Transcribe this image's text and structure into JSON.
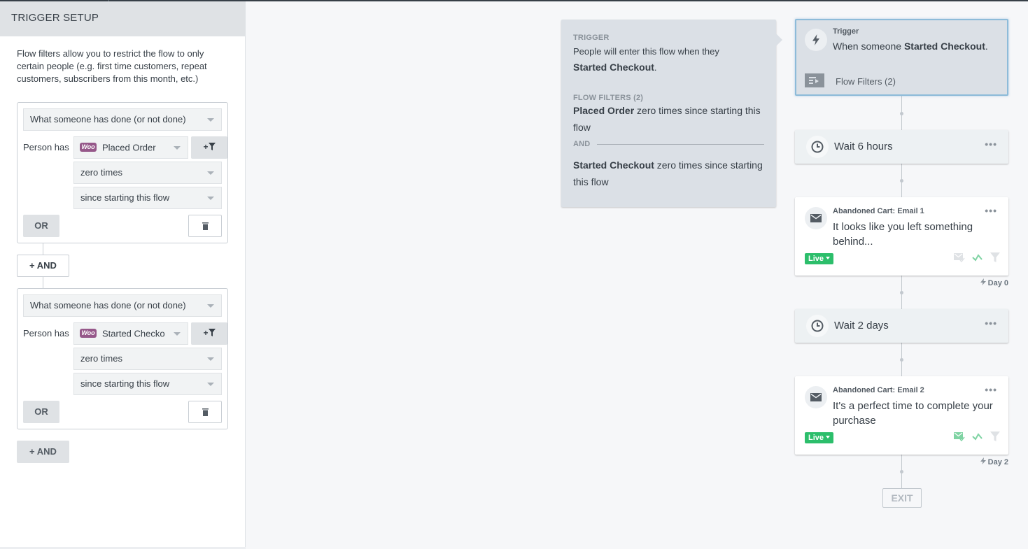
{
  "left_panel": {
    "title": "TRIGGER SETUP",
    "intro": "Flow filters allow you to restrict the flow to only certain people (e.g. first time customers, repeat customers, subscribers from this month, etc.)",
    "filters": [
      {
        "condition_type": "What someone has done (or not done)",
        "person_label": "Person has",
        "metric_icon": "woocommerce-icon",
        "metric_icon_text": "Woo",
        "metric": "Placed Order",
        "count": "zero times",
        "timeframe": "since starting this flow",
        "add_filter_label": "+",
        "or_label": "OR"
      },
      {
        "condition_type": "What someone has done (or not done)",
        "person_label": "Person has",
        "metric_icon": "woocommerce-icon",
        "metric_icon_text": "Woo",
        "metric": "Started Checko",
        "count": "zero times",
        "timeframe": "since starting this flow",
        "add_filter_label": "+",
        "or_label": "OR"
      }
    ],
    "and_label": "+ AND"
  },
  "tooltip": {
    "trigger_label": "TRIGGER",
    "trigger_text_prefix": "People will enter this flow when they",
    "trigger_text_bold": "Started Checkout",
    "trigger_text_suffix": ".",
    "filters_label": "FLOW FILTERS (2)",
    "filter1_bold": "Placed Order",
    "filter1_rest": " zero times since starting this flow",
    "and_label": "AND",
    "filter2_bold": "Started Checkout",
    "filter2_rest": " zero times since starting this flow"
  },
  "flow": {
    "trigger": {
      "small_label": "Trigger",
      "text_prefix": "When someone ",
      "text_bold": "Started Checkout",
      "text_suffix": ".",
      "filters_label": "Flow Filters (2)"
    },
    "steps": [
      {
        "type": "wait",
        "label": "Wait 6 hours",
        "menu": "•••"
      },
      {
        "type": "email",
        "name": "Abandoned Cart: Email 1",
        "subject": "It looks like you left something behind...",
        "status": "Live",
        "day": "Day 0",
        "menu": "•••",
        "smart_sending_active": false
      },
      {
        "type": "wait",
        "label": "Wait 2 days",
        "menu": "•••"
      },
      {
        "type": "email",
        "name": "Abandoned Cart: Email 2",
        "subject": "It's a perfect time to complete your purchase",
        "status": "Live",
        "day": "Day 2",
        "menu": "•••",
        "smart_sending_active": true
      }
    ],
    "exit_label": "EXIT"
  },
  "colors": {
    "live_green": "#2cbe6b",
    "selected_border": "#8dbbd9",
    "woo_purple": "#96588a"
  }
}
